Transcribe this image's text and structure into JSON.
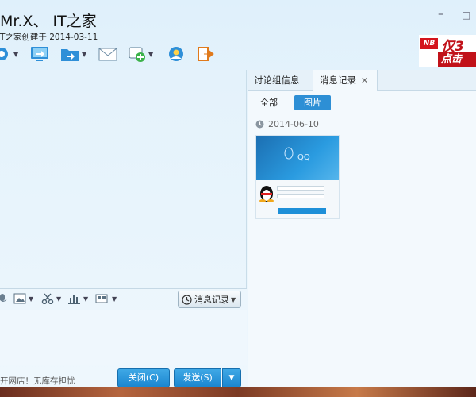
{
  "window": {
    "title": "Mr.X、 IT之家",
    "subtitle": "T之家创建于 2014-03-11",
    "minimize_glyph": "–",
    "maximize_glyph": "□"
  },
  "ad": {
    "brand": "NB",
    "top_text": "仅3",
    "bottom_text": "点击"
  },
  "toolbar": {
    "items": [
      {
        "icon": "video-call-icon",
        "has_dropdown": true
      },
      {
        "icon": "screen-share-icon",
        "has_dropdown": false
      },
      {
        "icon": "file-transfer-icon",
        "has_dropdown": true
      },
      {
        "icon": "mail-icon",
        "has_dropdown": false
      },
      {
        "icon": "add-app-icon",
        "has_dropdown": true
      },
      {
        "icon": "group-member-icon",
        "has_dropdown": false
      },
      {
        "icon": "exit-icon",
        "has_dropdown": false
      }
    ]
  },
  "input_toolbar": {
    "history_label": "消息记录",
    "items": [
      {
        "icon": "voice-icon"
      },
      {
        "icon": "image-icon"
      },
      {
        "icon": "screenshot-scissors-icon"
      },
      {
        "icon": "music-bars-icon"
      },
      {
        "icon": "more-icon"
      }
    ]
  },
  "footer": {
    "notice": "开网店！无库存担忧",
    "close_label": "关闭(C)",
    "send_label": "发送(S)"
  },
  "right_panel": {
    "tabs": [
      {
        "label": "讨论组信息"
      },
      {
        "label": "消息记录",
        "closable": true
      }
    ],
    "filters": {
      "all": "全部",
      "pictures": "图片"
    },
    "date": "2014-06-10",
    "thumbnail_text": "QQ"
  },
  "colors": {
    "accent": "#2d8fd5",
    "button_blue": "#1b86cf",
    "ad_red": "#c1121a"
  }
}
